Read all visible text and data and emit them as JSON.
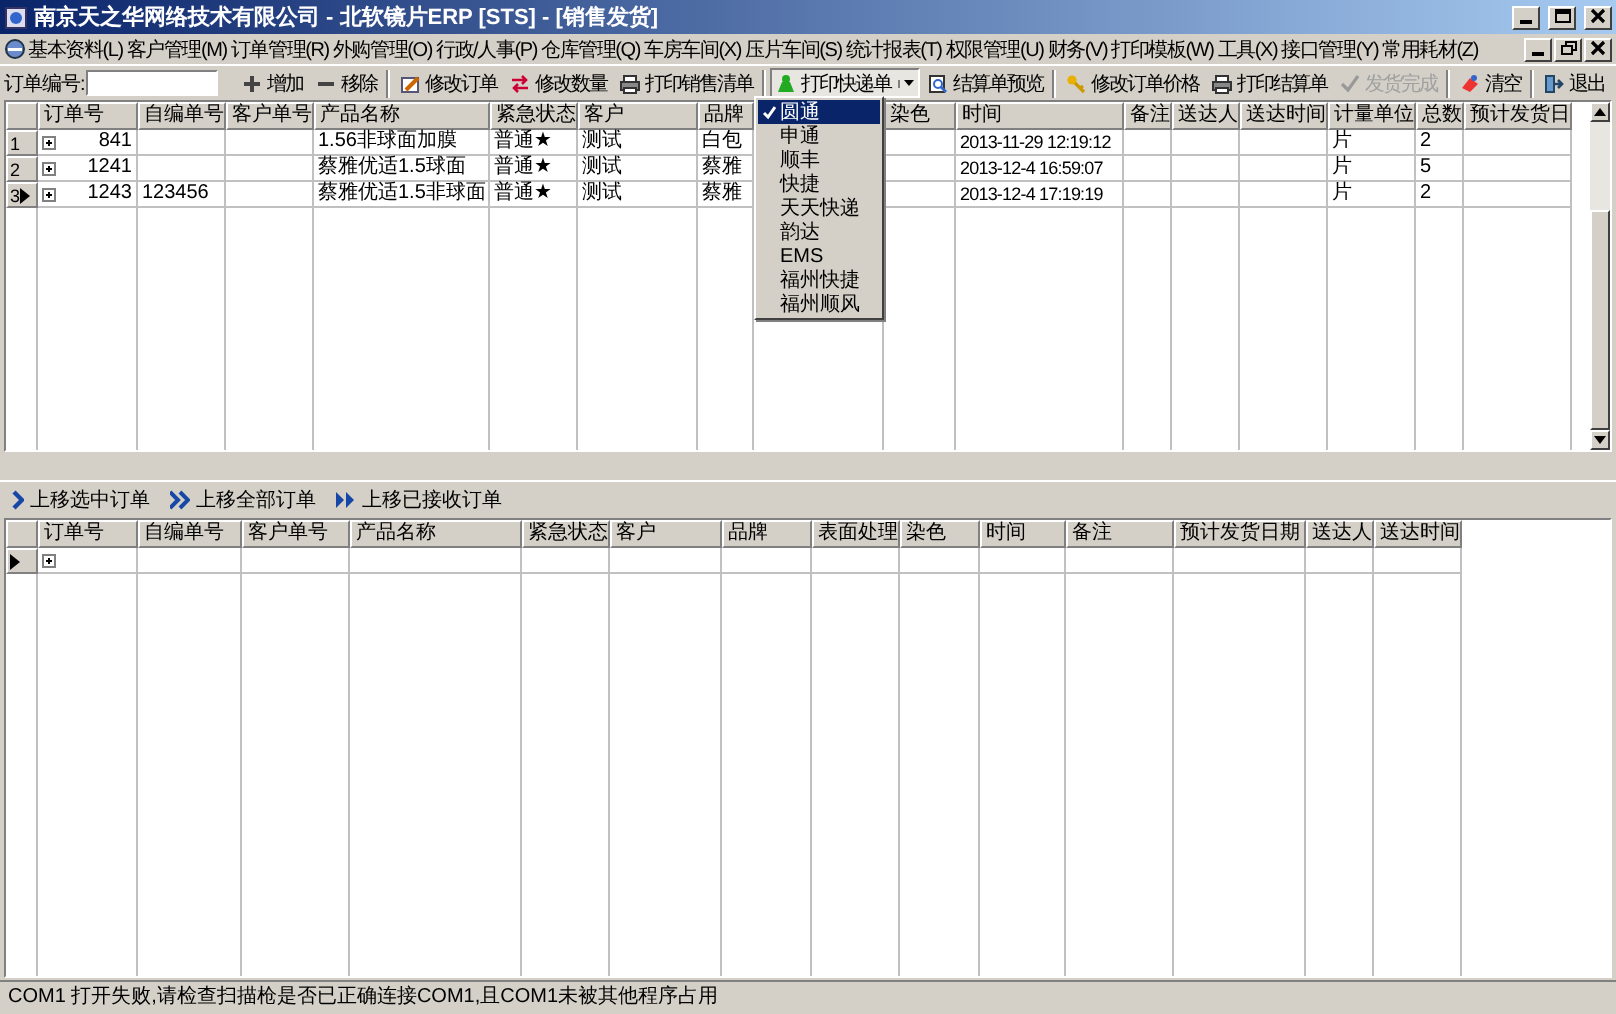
{
  "window": {
    "title": "南京天之华网络技术有限公司 - 北软镜片ERP [STS] - [销售发货]"
  },
  "menu_bar": {
    "items": [
      "基本资料(L)",
      "客户管理(M)",
      "订单管理(R)",
      "外购管理(O)",
      "行政/人事(P)",
      "仓库管理(Q)",
      "车房车间(X)",
      "压片车间(S)",
      "统计报表(T)",
      "权限管理(U)",
      "财务(V)",
      "打印模板(W)",
      "工具(X)",
      "接口管理(Y)",
      "常用耗材(Z)"
    ]
  },
  "toolbar": {
    "order_no_label": "订单编号:",
    "items": [
      {
        "kind": "button",
        "label": "增加",
        "pressed": false,
        "disabled": false
      },
      {
        "kind": "button",
        "label": "移除",
        "pressed": false,
        "disabled": false
      },
      {
        "kind": "separator"
      },
      {
        "kind": "button",
        "label": "修改订单",
        "pressed": false,
        "disabled": false
      },
      {
        "kind": "button",
        "label": "修改数量",
        "pressed": false,
        "disabled": false
      },
      {
        "kind": "button",
        "label": "打印销售清单",
        "pressed": false,
        "disabled": false
      },
      {
        "kind": "separator"
      },
      {
        "kind": "dropdown",
        "label": "打印快递单",
        "pressed": true,
        "disabled": false
      },
      {
        "kind": "button",
        "label": "结算单预览",
        "pressed": false,
        "disabled": false
      },
      {
        "kind": "separator"
      },
      {
        "kind": "button",
        "label": "修改订单价格",
        "pressed": false,
        "disabled": false
      },
      {
        "kind": "button",
        "label": "打印结算单",
        "pressed": false,
        "disabled": false
      },
      {
        "kind": "button",
        "label": "发货完成",
        "pressed": false,
        "disabled": true
      },
      {
        "kind": "separator"
      },
      {
        "kind": "button",
        "label": "清空",
        "pressed": false,
        "disabled": false
      },
      {
        "kind": "separator"
      },
      {
        "kind": "button",
        "label": "退出",
        "pressed": false,
        "disabled": false
      }
    ]
  },
  "express_menu": {
    "items": [
      {
        "label": "圆通",
        "checked": true,
        "selected": true
      },
      {
        "label": "申通",
        "checked": false,
        "selected": false
      },
      {
        "label": "顺丰",
        "checked": false,
        "selected": false
      },
      {
        "label": "快捷",
        "checked": false,
        "selected": false
      },
      {
        "label": "天天快递",
        "checked": false,
        "selected": false
      },
      {
        "label": "韵达",
        "checked": false,
        "selected": false
      },
      {
        "label": "EMS",
        "checked": false,
        "selected": false
      },
      {
        "label": "福州快捷",
        "checked": false,
        "selected": false
      },
      {
        "label": "福州顺风",
        "checked": false,
        "selected": false
      }
    ]
  },
  "upper_grid": {
    "columns": [
      "订单号",
      "自编单号",
      "客户单号",
      "产品名称",
      "紧急状态",
      "客户",
      "品牌",
      "染色",
      "时间",
      "备注",
      "送达人",
      "送达时间",
      "计量单位",
      "总数",
      "预计发货日"
    ],
    "rows": [
      {
        "number": "1",
        "current": false,
        "cells": [
          "841",
          null,
          null,
          "1.56非球面加膜",
          "普通★",
          "测试",
          "白包",
          null,
          "2013-11-29 12:19:12",
          null,
          null,
          null,
          "片",
          "2",
          null
        ]
      },
      {
        "number": "2",
        "current": false,
        "cells": [
          "1241",
          null,
          null,
          "蔡雅优适1.5球面",
          "普通★",
          "测试",
          "蔡雅",
          null,
          "2013-12-4 16:59:07",
          null,
          null,
          null,
          "片",
          "5",
          null
        ]
      },
      {
        "number": "3",
        "current": true,
        "cells": [
          "1243",
          "123456",
          null,
          "蔡雅优适1.5非球面",
          "普通★",
          "测试",
          "蔡雅",
          null,
          "2013-12-4 17:19:19",
          null,
          null,
          null,
          "片",
          "2",
          null
        ]
      }
    ]
  },
  "lower_toolbar": {
    "buttons": [
      "上移选中订单",
      "上移全部订单",
      "上移已接收订单"
    ]
  },
  "lower_grid": {
    "columns": [
      "订单号",
      "自编单号",
      "客户单号",
      "产品名称",
      "紧急状态",
      "客户",
      "品牌",
      "表面处理",
      "染色",
      "时间",
      "备注",
      "预计发货日期",
      "送达人",
      "送达时间"
    ],
    "rows": [
      {
        "current": true
      }
    ]
  },
  "status_bar": {
    "text": "COM1 打开失败,请检查扫描枪是否已正确连接COM1,且COM1未被其他程序占用"
  }
}
